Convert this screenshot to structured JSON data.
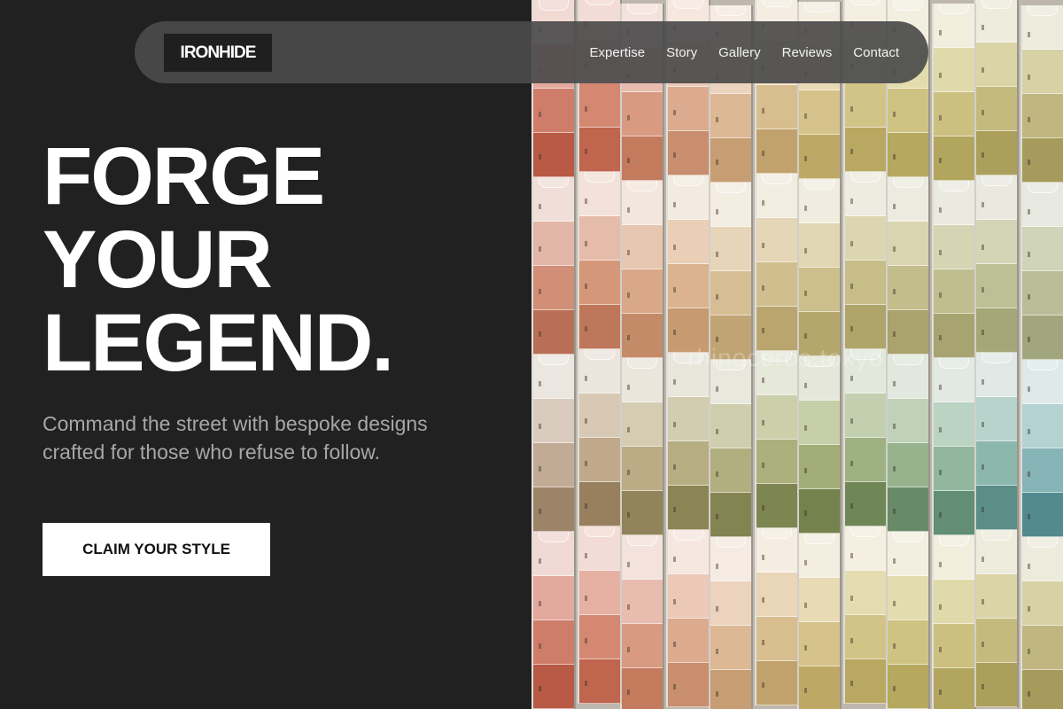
{
  "nav": {
    "logo": "IRONHIDE",
    "links": [
      "Expertise",
      "Story",
      "Gallery",
      "Reviews",
      "Contact"
    ]
  },
  "hero": {
    "headline": [
      "FORGE",
      "YOUR",
      "LEGEND."
    ],
    "subtext": "Command the street with bespoke designs crafted for those who refuse to follow.",
    "cta_label": "CLAIM YOUR STYLE"
  },
  "image": {
    "watermark": "rhinoceros.tokyo"
  },
  "colors": {
    "background": "#212121",
    "text_primary": "#ffffff",
    "text_secondary": "#a7a7a7",
    "nav_bg": "#4b4b4b",
    "button_bg": "#ffffff",
    "button_text": "#111111"
  }
}
